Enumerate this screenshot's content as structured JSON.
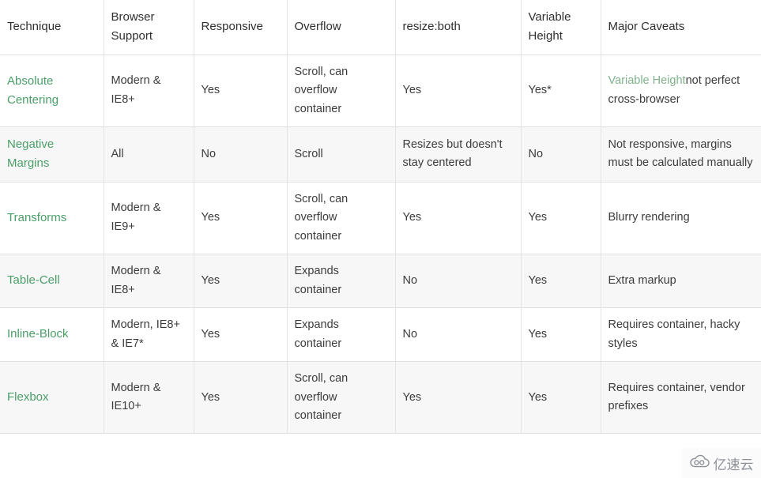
{
  "table": {
    "columns": [
      "Technique",
      "Browser Support",
      "Responsive",
      "Overflow",
      "resize:both",
      "Variable Height",
      "Major Caveats"
    ],
    "rows": [
      {
        "technique": "Absolute Centering",
        "browser_support": "Modern & IE8+",
        "responsive": "Yes",
        "overflow": "Scroll, can overflow container",
        "resize_both": "Yes",
        "variable_height": "Yes*",
        "caveat_link": "Variable Height",
        "caveat_rest": "not perfect cross-browser",
        "shaded": false
      },
      {
        "technique": "Negative Margins",
        "browser_support": "All",
        "responsive": "No",
        "overflow": "Scroll",
        "resize_both": "Resizes but doesn't stay centered",
        "variable_height": "No",
        "caveat_link": "",
        "caveat_rest": "Not responsive, margins must be calculated manually",
        "shaded": true
      },
      {
        "technique": "Transforms",
        "browser_support": "Modern & IE9+",
        "responsive": "Yes",
        "overflow": "Scroll, can overflow container",
        "resize_both": "Yes",
        "variable_height": "Yes",
        "caveat_link": "",
        "caveat_rest": "Blurry rendering",
        "shaded": false
      },
      {
        "technique": "Table-Cell",
        "browser_support": "Modern & IE8+",
        "responsive": "Yes",
        "overflow": "Expands container",
        "resize_both": "No",
        "variable_height": "Yes",
        "caveat_link": "",
        "caveat_rest": "Extra markup",
        "shaded": true
      },
      {
        "technique": "Inline-Block",
        "browser_support": "Modern, IE8+ & IE7*",
        "responsive": "Yes",
        "overflow": "Expands container",
        "resize_both": "No",
        "variable_height": "Yes",
        "caveat_link": "",
        "caveat_rest": "Requires container, hacky styles",
        "shaded": false
      },
      {
        "technique": "Flexbox",
        "browser_support": "Modern & IE10+",
        "responsive": "Yes",
        "overflow": "Scroll, can overflow container",
        "resize_both": "Yes",
        "variable_height": "Yes",
        "caveat_link": "",
        "caveat_rest": "Requires container, vendor prefixes",
        "shaded": true
      }
    ]
  },
  "watermark": {
    "text": "亿速云",
    "icon": "cloud-logo-icon",
    "color": "#8d9198"
  },
  "colors": {
    "technique_green": "#4a9e68",
    "link_green": "#7fb28c",
    "text": "#3c3c3c",
    "header_text": "#2f2f2f",
    "row_shaded_bg": "#f7f7f7",
    "row_plain_bg": "#ffffff",
    "border": "#e0e0e0"
  }
}
